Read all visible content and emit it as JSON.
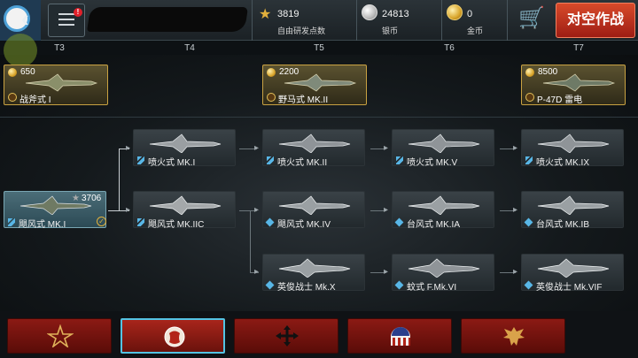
{
  "topbar": {
    "research_points": {
      "value": "3819",
      "label": "自由研发点数",
      "icon": "star-icon"
    },
    "silver": {
      "value": "24813",
      "label": "银币",
      "icon": "silver-coin-icon"
    },
    "gold": {
      "value": "0",
      "label": "金币",
      "icon": "gold-coin-icon"
    },
    "notification_badge": "!",
    "battle_button": "对空作战"
  },
  "tiers": [
    "T3",
    "T4",
    "T5",
    "T6",
    "T7"
  ],
  "premium": [
    {
      "price": "650",
      "name": "战斧式 I"
    },
    {
      "price": "2200",
      "name": "野马式 MK.II"
    },
    {
      "price": "8500",
      "name": "P-47D 雷电"
    }
  ],
  "tree": {
    "start": {
      "name": "飓风式 MK.I",
      "rp": "3706"
    },
    "row1": [
      "喷火式 MK.I",
      "喷火式 MK.II",
      "喷火式 MK.V",
      "喷火式 MK.IX"
    ],
    "row2": [
      "飓风式 MK.IIC",
      "飓风式 MK.IV",
      "台风式 MK.IA",
      "台风式 MK.IB"
    ],
    "row3": [
      "英俊战士 Mk.X",
      "蚊式 F.Mk.VI",
      "英俊战士 Mk.VIF"
    ]
  },
  "colors": {
    "accent_blue": "#54c3e3",
    "nation_red": "#8b1a14",
    "gold": "#e3b23c",
    "battle_red": "#c0361f"
  },
  "nations": [
    "ussr-star-emblem",
    "uk-lion-emblem",
    "cross-arrows-emblem",
    "usa-shield-emblem",
    "germany-eagle-emblem"
  ]
}
